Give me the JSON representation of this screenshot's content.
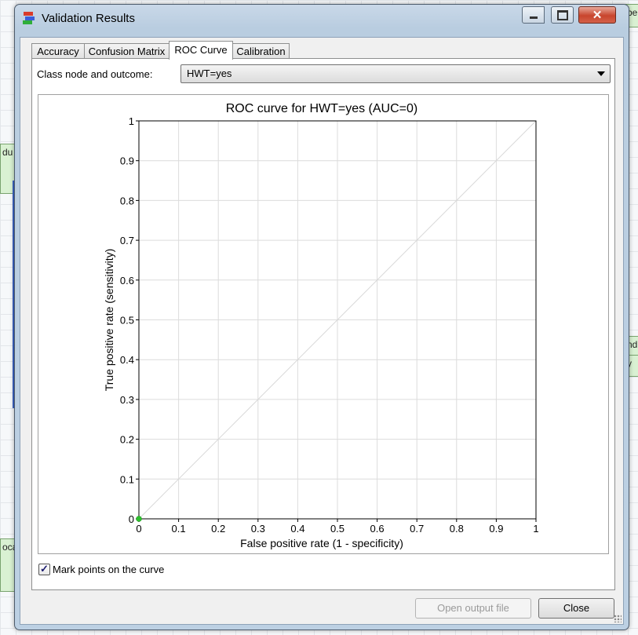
{
  "window": {
    "title": "Validation Results"
  },
  "background": {
    "nodes": [
      {
        "text": "du"
      },
      {
        "text": "be"
      },
      {
        "text": "nd"
      },
      {
        "text": "y"
      },
      {
        "text": "oca"
      }
    ]
  },
  "tabs": [
    {
      "label": "Accuracy",
      "active": false
    },
    {
      "label": "Confusion Matrix",
      "active": false
    },
    {
      "label": "ROC Curve",
      "active": true
    },
    {
      "label": "Calibration",
      "active": false
    }
  ],
  "selector": {
    "label": "Class node and outcome:",
    "value": "HWT=yes"
  },
  "chart_data": {
    "type": "line",
    "title": "ROC curve for HWT=yes (AUC=0)",
    "xlabel": "False positive rate (1 - specificity)",
    "ylabel": "True positive rate (sensitivity)",
    "xlim": [
      0,
      1
    ],
    "ylim": [
      0,
      1
    ],
    "grid": true,
    "x_ticks": [
      "0",
      "0.1",
      "0.2",
      "0.3",
      "0.4",
      "0.5",
      "0.6",
      "0.7",
      "0.8",
      "0.9",
      "1"
    ],
    "y_ticks": [
      "0",
      "0.1",
      "0.2",
      "0.3",
      "0.4",
      "0.5",
      "0.6",
      "0.7",
      "0.8",
      "0.9",
      "1"
    ],
    "reference_line": {
      "x": [
        0,
        1
      ],
      "y": [
        0,
        1
      ],
      "color": "#d8d8d8"
    },
    "series": [
      {
        "x": [
          0
        ],
        "y": [
          0
        ],
        "color": "#2ec02e",
        "marked": true
      }
    ]
  },
  "options": {
    "mark_points_label": "Mark points on the curve",
    "mark_points_checked": true
  },
  "buttons": {
    "open_output": "Open output file",
    "close": "Close"
  },
  "colors": {
    "accent": "#3a63c4",
    "close_button": "#c8452d"
  }
}
